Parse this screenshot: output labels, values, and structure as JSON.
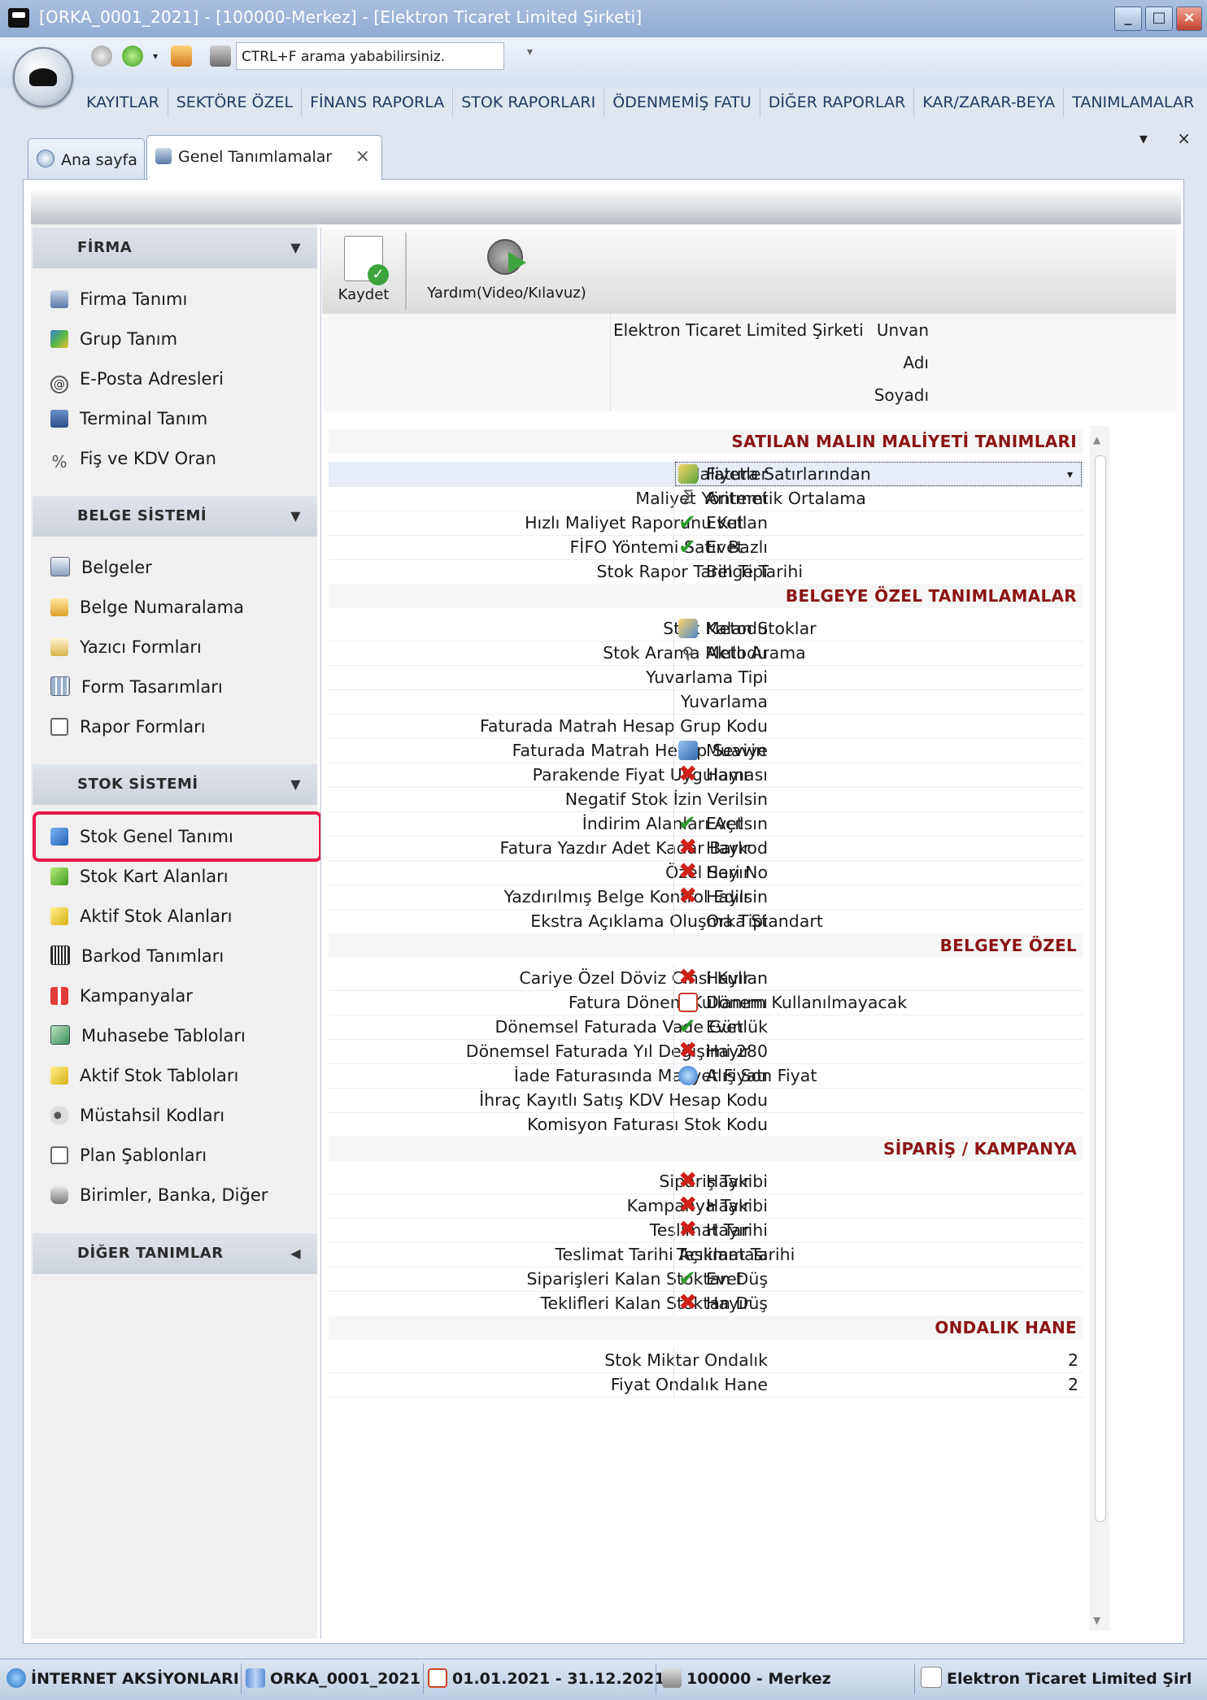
{
  "window": {
    "title": "[ORKA_0001_2021]  -  [100000-Merkez]  -  [Elektron Ticaret Limited Şirketi]",
    "controls": [
      "_",
      "□",
      "×"
    ]
  },
  "quickbar": {
    "search_placeholder": "CTRL+F arama yababilirsiniz."
  },
  "menu": [
    "KAYITLAR",
    "SEKTÖRE ÖZEL",
    "FİNANS RAPORLA",
    "STOK RAPORLARI",
    "ÖDENMEMİŞ FATU",
    "DİĞER RAPORLAR",
    "KAR/ZARAR-BEYA",
    "TANIMLAMALAR"
  ],
  "tabs": [
    {
      "label": "Ana sayfa"
    },
    {
      "label": "Genel Tanımlamalar",
      "close": "×"
    }
  ],
  "tab_controls": {
    "dropdown": "▾",
    "close": "×"
  },
  "leftnav": {
    "groups": [
      {
        "title": "FİRMA",
        "arrow": "▼",
        "items": [
          "Firma Tanımı",
          "Grup Tanım",
          "E-Posta Adresleri",
          "Terminal Tanım",
          "Fiş ve KDV Oran"
        ]
      },
      {
        "title": "BELGE SİSTEMİ",
        "arrow": "▼",
        "items": [
          "Belgeler",
          "Belge Numaralama",
          "Yazıcı Formları",
          "Form Tasarımları",
          "Rapor Formları"
        ]
      },
      {
        "title": "STOK SİSTEMİ",
        "arrow": "▼",
        "items": [
          "Stok Genel Tanımı",
          "Stok Kart Alanları",
          "Aktif Stok Alanları",
          "Barkod Tanımları",
          "Kampanyalar",
          "Muhasebe Tabloları",
          "Aktif Stok Tabloları",
          "Müstahsil Kodları",
          "Plan Şablonları",
          "Birimler, Banka, Diğer"
        ]
      },
      {
        "title": "DİĞER TANIMLAR",
        "arrow": "◀",
        "items": []
      }
    ]
  },
  "toolbar": {
    "save_label": "Kaydet",
    "help_label": "Yardım(Video/Kılavuz)"
  },
  "header_form": {
    "unvan_label": "Unvan",
    "unvan_value": "Elektron Ticaret Limited Şirketi",
    "adi_label": "Adı",
    "soyadi_label": "Soyadı"
  },
  "property_grid": {
    "sections": [
      {
        "title": "SATILAN MALIN MALİYETİ TANIMLARI",
        "rows": [
          {
            "label": "Maliyetler",
            "value": "Fatura Satırlarından",
            "icon": "invoice-icon",
            "selected": true,
            "dropdown": "▾"
          },
          {
            "label": "Maliyet Yöntemi",
            "value": "Aritmetik Ortalama",
            "icon": "sigma-icon"
          },
          {
            "label": "Hızlı Maliyet Raporunu Kullan",
            "value": "Evet",
            "icon": "check-icon"
          },
          {
            "label": "FİFO Yöntemi Satır Bazlı",
            "value": "Evet",
            "icon": "check-icon"
          },
          {
            "label": "Stok Rapor Tarih Tipi",
            "value": "Belge Tarihi",
            "icon": ""
          }
        ]
      },
      {
        "title": "BELGEYE ÖZEL TANIMLAMALAR",
        "rows": [
          {
            "label": "Stok Metodu",
            "value": "Kalan Stoklar",
            "icon": "boxes-icon"
          },
          {
            "label": "Stok Arama Metodu",
            "value": "Akıllı Arama",
            "icon": "magnifier-icon"
          },
          {
            "label": "Yuvarlama Tipi",
            "value": "",
            "icon": ""
          },
          {
            "label": "Yuvarlama",
            "value": "",
            "icon": ""
          },
          {
            "label": "Faturada Matrah Hesap Grup Kodu",
            "value": "",
            "icon": ""
          },
          {
            "label": "Faturada Matrah Hesap Seviye",
            "value": "Muavin",
            "icon": "hierarchy-icon"
          },
          {
            "label": "Parakende Fiyat Uygulaması",
            "value": "Hayır",
            "icon": "cross-icon"
          },
          {
            "label": "Negatif Stok İzin Verilsin",
            "value": "",
            "icon": ""
          },
          {
            "label": "İndirim Alanları Açılsın",
            "value": "Evet",
            "icon": "check-icon"
          },
          {
            "label": "Fatura Yazdır Adet Kadar Barkod",
            "value": "Hayır",
            "icon": "cross-icon"
          },
          {
            "label": "Özel Seri No",
            "value": "Hayır",
            "icon": "cross-icon"
          },
          {
            "label": "Yazdırılmış Belge Kontrol Edilsin",
            "value": "Hayır",
            "icon": "cross-icon"
          },
          {
            "label": "Ekstra Açıklama Oluşma Tipi",
            "value": "Orka Standart",
            "icon": ""
          }
        ]
      },
      {
        "title": "BELGEYE ÖZEL",
        "rows": [
          {
            "label": "Cariye Özel Döviz Cinsi Kullan",
            "value": "Hayır",
            "icon": "cross-icon"
          },
          {
            "label": "Fatura Dönem Kullanımı",
            "value": "Dönem Kullanılmayacak",
            "icon": "calendar-warning-icon"
          },
          {
            "label": "Dönemsel Faturada Vade Günlük",
            "value": "Evet",
            "icon": "check-icon"
          },
          {
            "label": "Dönemsel Faturada Yıl Değişimi 280",
            "value": "Hayır",
            "icon": "cross-icon"
          },
          {
            "label": "İade Faturasında Maliyet Fiyatı",
            "value": "Alış Son Fiyat",
            "icon": "return-icon"
          },
          {
            "label": "İhraç Kayıtlı Satış KDV Hesap Kodu",
            "value": "",
            "icon": ""
          },
          {
            "label": "Komisyon Faturası Stok Kodu",
            "value": "",
            "icon": ""
          }
        ]
      },
      {
        "title": "SİPARİŞ / KAMPANYA",
        "rows": [
          {
            "label": "Sipariş Takibi",
            "value": "Hayır",
            "icon": "cross-icon"
          },
          {
            "label": "Kampanya Takibi",
            "value": "Hayır",
            "icon": "cross-icon"
          },
          {
            "label": "Teslimat Tarihi",
            "value": "Hayır",
            "icon": "cross-icon"
          },
          {
            "label": "Teslimat Tarihi Açıklaması",
            "value": "Teslimat Tarihi",
            "icon": "",
            "flush": true
          },
          {
            "label": "Siparişleri Kalan Stoktan Düş",
            "value": "Evet",
            "icon": "check-icon"
          },
          {
            "label": "Teklifleri Kalan Stoktan Düş",
            "value": "Hayır",
            "icon": "cross-icon"
          }
        ]
      },
      {
        "title": "ONDALIK HANE",
        "rows": [
          {
            "label": "Stok Miktar Ondalık",
            "value": "2",
            "icon": "",
            "right": true
          },
          {
            "label": "Fiyat Ondalık Hane",
            "value": "2",
            "icon": "",
            "right": true
          }
        ]
      }
    ]
  },
  "statusbar": [
    {
      "text": "İNTERNET AKSİYONLARI",
      "icon": "globe-icon"
    },
    {
      "text": "ORKA_0001_2021",
      "icon": "database-icon"
    },
    {
      "text": "01.01.2021 - 31.12.2021",
      "icon": "calendar-icon"
    },
    {
      "text": "100000 - Merkez",
      "icon": "warehouse-icon"
    },
    {
      "text": "Elektron Ticaret Limited Şirl",
      "icon": "edit-icon"
    }
  ],
  "colors": {
    "section_title": "#8b1414",
    "highlight_border": "#e8174c",
    "check": "#2f9a2f",
    "cross": "#d0201a"
  }
}
